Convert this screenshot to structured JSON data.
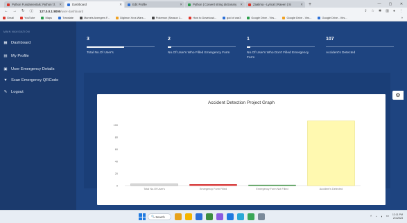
{
  "browser": {
    "tabs": [
      {
        "label": "Python Fundamentals: Python f.l.",
        "color": "#d9352b"
      },
      {
        "label": "Dashboard",
        "color": "#2b6fd6",
        "active": true
      },
      {
        "label": "Edit Profile",
        "color": "#2b6fd6"
      },
      {
        "label": "Python | Convert string dictionary",
        "color": "#2a9d4a"
      },
      {
        "label": "Zaalima - Lyrical | Raeen | Si",
        "color": "#d9352b"
      }
    ],
    "new_tab": "+",
    "window_controls": [
      "—",
      "▢",
      "✕"
    ],
    "url_host": "127.0.0.1:8000",
    "url_path": "/user-dashboard",
    "bookmarks": [
      {
        "label": "Gmail",
        "color": "#d9352b"
      },
      {
        "label": "YouTube",
        "color": "#e0342a"
      },
      {
        "label": "Maps",
        "color": "#2a9d4a"
      },
      {
        "label": "Translate",
        "color": "#2b6fd6"
      },
      {
        "label": "Marvels Avengers F...",
        "color": "#444"
      },
      {
        "label": "Digimon Xros Wars...",
        "color": "#f0a020"
      },
      {
        "label": "Pokemon (Season 1...",
        "color": "#444"
      },
      {
        "label": "How to Download...",
        "color": "#e0342a"
      },
      {
        "label": "god of war3",
        "color": "#2b6fd6"
      },
      {
        "label": "Google Drive - Virs...",
        "color": "#2a9d4a"
      },
      {
        "label": "Google Drive - Virs...",
        "color": "#f0a020"
      },
      {
        "label": "Google Drive - Virs...",
        "color": "#2b6fd6"
      }
    ],
    "bookmarks_more": "»"
  },
  "sidebar": {
    "heading": "MAIN NAVIGATION",
    "items": [
      {
        "label": "Dashboard",
        "icon": "▦"
      },
      {
        "label": "My Profile",
        "icon": "▤"
      },
      {
        "label": "User Emergency Details",
        "icon": "▣"
      },
      {
        "label": "Scan Emergency QRCode",
        "icon": "▼"
      },
      {
        "label": "Logout",
        "icon": "✎"
      }
    ]
  },
  "stats": [
    {
      "value": "3",
      "label": "Total No.Of User's",
      "fill": 0.55
    },
    {
      "value": "2",
      "label": "No.Of User's Who Filled Emergency Form",
      "fill": 0.05
    },
    {
      "value": "1",
      "label": "No.Of User's Who Don't Filled Emergency Form",
      "fill": 0.05
    },
    {
      "value": "107",
      "label": "Accident's Detected",
      "fill": 0
    }
  ],
  "settings_icon": "⚙",
  "chart_data": {
    "type": "bar",
    "title": "Accident Detection Project Graph",
    "categories": [
      "Total No.Of User's",
      "Emergency Form Filled",
      "Emergency Form Not Filled",
      "Accident's Detected"
    ],
    "values": [
      3,
      2,
      1,
      107
    ],
    "colors": [
      "#d8d8d8",
      "#e33b3b",
      "#4caf50",
      "#fff9b0"
    ],
    "edge_colors": [
      "#aaaaaa",
      "#c62828",
      "#2e7d32",
      "#e6dc70"
    ],
    "yticks": [
      0,
      20,
      40,
      60,
      80,
      100
    ],
    "ylim": [
      0,
      110
    ],
    "grid": false
  },
  "taskbar": {
    "search_label": "Search",
    "apps": [
      "#e7a21a",
      "#f4b400",
      "#2b6fd6",
      "#3c8d40",
      "#8a5be0",
      "#1f7ae0",
      "#2aa8d6",
      "#3aa757",
      "#7a8a9a"
    ],
    "tray_text": "ENG\nIN",
    "time": "12:11 PM",
    "date": "2/1/2023"
  }
}
